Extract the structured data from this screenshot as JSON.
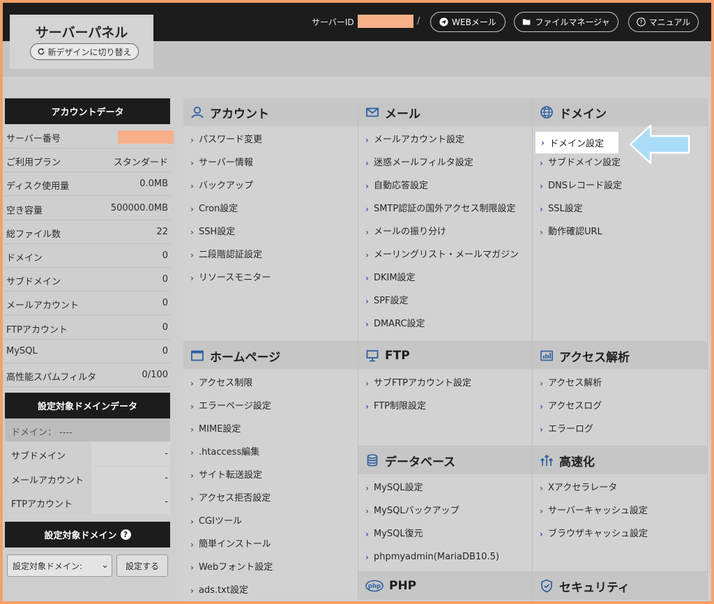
{
  "header": {
    "panel_title": "サーバーパネル",
    "switch_label": "新デザインに切り替え",
    "server_id_label": "サーバーID",
    "separator": "/",
    "webmail_label": "WEBメール",
    "filemanager_label": "ファイルマネージャ",
    "manual_label": "マニュアル"
  },
  "account": {
    "heading": "アカウントデータ",
    "rows": [
      {
        "key": "サーバー番号",
        "value": ""
      },
      {
        "key": "ご利用プラン",
        "value": "スタンダード"
      },
      {
        "key": "ディスク使用量",
        "value": "0.0MB"
      },
      {
        "key": "空き容量",
        "value": "500000.0MB"
      },
      {
        "key": "総ファイル数",
        "value": "22"
      },
      {
        "key": "ドメイン",
        "value": "0"
      },
      {
        "key": "サブドメイン",
        "value": "0"
      },
      {
        "key": "メールアカウント",
        "value": "0"
      },
      {
        "key": "FTPアカウント",
        "value": "0"
      },
      {
        "key": "MySQL",
        "value": "0"
      },
      {
        "key": "高性能スパムフィルタ",
        "value": "0/100"
      }
    ]
  },
  "target_domain_data": {
    "heading": "設定対象ドメインデータ",
    "domain_label": "ドメイン： ----",
    "rows": [
      {
        "key": "サブドメイン",
        "value": "-"
      },
      {
        "key": "メールアカウント",
        "value": "-"
      },
      {
        "key": "FTPアカウント",
        "value": "-"
      }
    ]
  },
  "target_domain": {
    "heading": "設定対象ドメイン",
    "help": "?",
    "select_value": "設定対象ドメイン:",
    "chevron": "⌄",
    "set_button": "設定する"
  },
  "sections": {
    "account": {
      "title": "アカウント",
      "items": [
        "パスワード変更",
        "サーバー情報",
        "バックアップ",
        "Cron設定",
        "SSH設定",
        "二段階認証設定",
        "リソースモニター"
      ]
    },
    "mail": {
      "title": "メール",
      "items": [
        "メールアカウント設定",
        "迷惑メールフィルタ設定",
        "自動応答設定",
        "SMTP認証の国外アクセス制限設定",
        "メールの振り分け",
        "メーリングリスト・メールマガジン",
        "DKIM設定",
        "SPF設定",
        "DMARC設定"
      ]
    },
    "domain": {
      "title": "ドメイン",
      "highlighted": "ドメイン設定",
      "items": [
        "サブドメイン設定",
        "DNSレコード設定",
        "SSL設定",
        "動作確認URL"
      ]
    },
    "homepage": {
      "title": "ホームページ",
      "items": [
        "アクセス制限",
        "エラーページ設定",
        "MIME設定",
        ".htaccess編集",
        "サイト転送設定",
        "アクセス拒否設定",
        "CGIツール",
        "簡単インストール",
        "Webフォント設定",
        "ads.txt設定"
      ]
    },
    "ftp": {
      "title": "FTP",
      "items": [
        "サブFTPアカウント設定",
        "FTP制限設定"
      ]
    },
    "access": {
      "title": "アクセス解析",
      "items": [
        "アクセス解析",
        "アクセスログ",
        "エラーログ"
      ]
    },
    "database": {
      "title": "データベース",
      "items": [
        "MySQL設定",
        "MySQLバックアップ",
        "MySQL復元",
        "phpmyadmin(MariaDB10.5)"
      ]
    },
    "speed": {
      "title": "高速化",
      "items": [
        "Xアクセラレータ",
        "サーバーキャッシュ設定",
        "ブラウザキャッシュ設定"
      ]
    },
    "php": {
      "title": "PHP",
      "items": []
    },
    "security": {
      "title": "セキュリティ",
      "items": []
    }
  },
  "icons": {
    "account": "user-icon",
    "mail": "envelope-icon",
    "domain": "globe-icon",
    "homepage": "window-icon",
    "ftp": "monitor-icon",
    "access": "bar-chart-icon",
    "database": "database-icon",
    "speed": "speed-icon",
    "php": "php-icon",
    "security": "shield-icon"
  },
  "colors": {
    "accent": "#2d5fa3",
    "callout": "#a9dcf7",
    "mask": "#f7b089"
  }
}
